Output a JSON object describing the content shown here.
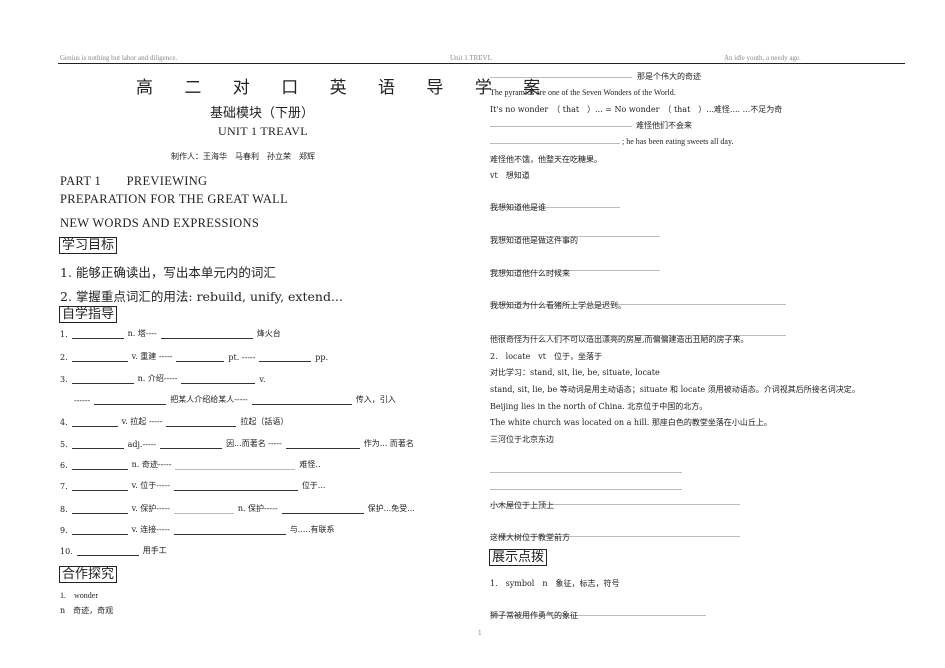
{
  "header": {
    "left": "Genius is nothing but labor and diligence.",
    "center": "Unit 1 TREVL",
    "right": "An idle youth, a needy age."
  },
  "doc": {
    "title": "高 二 对 口 英 语 导 学 案",
    "subtitle": "基础模块（下册）",
    "unit": "UNIT 1 TREAVL",
    "authors": "制作人：王海华　马春利　孙立荣　郑辉",
    "part": "PART 1　　PREVIEWING",
    "prep": "PREPARATION FOR THE GREAT WALL",
    "newwords": "NEW WORDS AND EXPRESSIONS"
  },
  "goals": {
    "heading": "学习目标",
    "g1": "1. 能够正确读出，写出本单元内的词汇",
    "g2": "2. 掌握重点词汇的用法: rebuild, unify, extend..."
  },
  "self": {
    "heading": "自学指导",
    "r1a": "1.",
    "r1b": "n. 塔----",
    "r1c": "烽火台",
    "r2a": "2.",
    "r2b": "v. 重建 -----",
    "r2c": "pt. -----",
    "r2d": "pp.",
    "r3a": "3.",
    "r3b": "n. 介绍-----",
    "r3c": "v.",
    "r3d": "------",
    "r3e": "把某人介绍给某人-----",
    "r3f": "传入，引入",
    "r4a": "4.",
    "r4b": "v. 拉起 -----",
    "r4c": "拉起（話语）",
    "r5a": "5.",
    "r5b": "adj.-----",
    "r5c": "因...而著名 -----",
    "r5d": "作为... 而著名",
    "r6a": "6.",
    "r6b": "n. 奇迹-----",
    "r6c": "难怪..",
    "r7a": "7.",
    "r7b": "v. 位于-----",
    "r7c": "位于...",
    "r8a": "8.",
    "r8b": "v. 保护-----",
    "r8c": "n. 保护-----",
    "r8d": "保护...免受...",
    "r9a": "9.",
    "r9b": "v. 连接-----",
    "r9c": "与.....有联系",
    "r10a": "10.",
    "r10b": "用手工"
  },
  "coop": {
    "heading": "合作探究",
    "w1": "1.　wonder",
    "w2": "n　奇迹，奇观"
  },
  "right": {
    "l1": "那是个伟大的奇迹",
    "l2": "The pyramids are one of the Seven Wonders of the World.",
    "l3": "It's no wonder　（ that　）... = No wonder　（ that　）...难怪.... ...不足为奇",
    "l4": "难怪他们不会来",
    "l5": "; he has been eating sweets all day.",
    "l6": "难怪他不饿，他整天在吃糖果。",
    "l7": "vt　想知道",
    "l8": "我想知道他是谁",
    "l9": "我想知道他是做这件事的",
    "l10": "我想知道他什么时候来",
    "l11": "我想知道为什么看猪所上学总是迟到。",
    "l12": "他很奇怪为什么人们不可以造出漂亮的房屋,而偏偏建造出丑陋的房子来。",
    "l13": "2.　locate　vt　位于，坐落于",
    "l14": "对比学习：stand, sit, lie, be, situate, locate",
    "l15": "stand, sit, lie, be 等动词是用主动语态；situate 和 locate 须用被动语态。介词视其后所接名词决定。",
    "l16": "Beijing lies in the north of China.  北京位于中国的北方。",
    "l17": "The white church was located on a hill.  那座白色的教堂坐落在小山丘上。",
    "l18": "三河位于北京东边",
    "l19": "小木屋位于上顶上",
    "l20": "这棵大树位于教堂前方",
    "l21": "展示点拨",
    "l22": "1.　symbol　n　象征，标志，符号",
    "l23": "狮子常被用作勇气的象征"
  },
  "page_number": "1"
}
